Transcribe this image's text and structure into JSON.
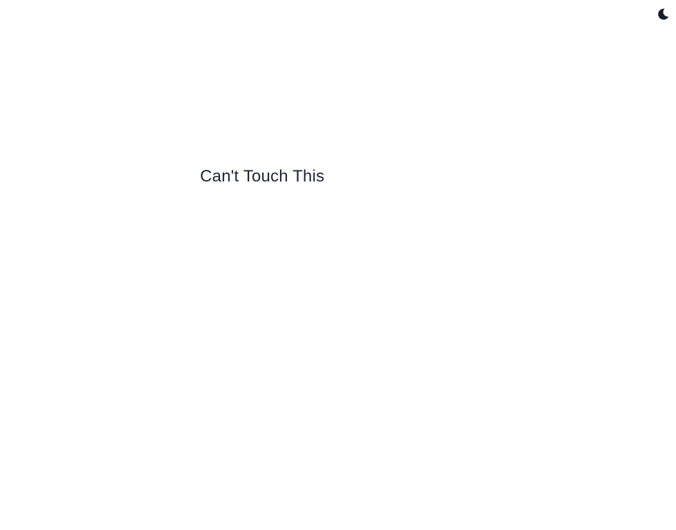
{
  "header": {
    "theme_toggle_icon": "moon-icon",
    "icon_color": "#1a1d2b"
  },
  "main": {
    "headline": "Can't Touch This"
  },
  "colors": {
    "background": "#ffffff",
    "text": "#1f2433"
  }
}
